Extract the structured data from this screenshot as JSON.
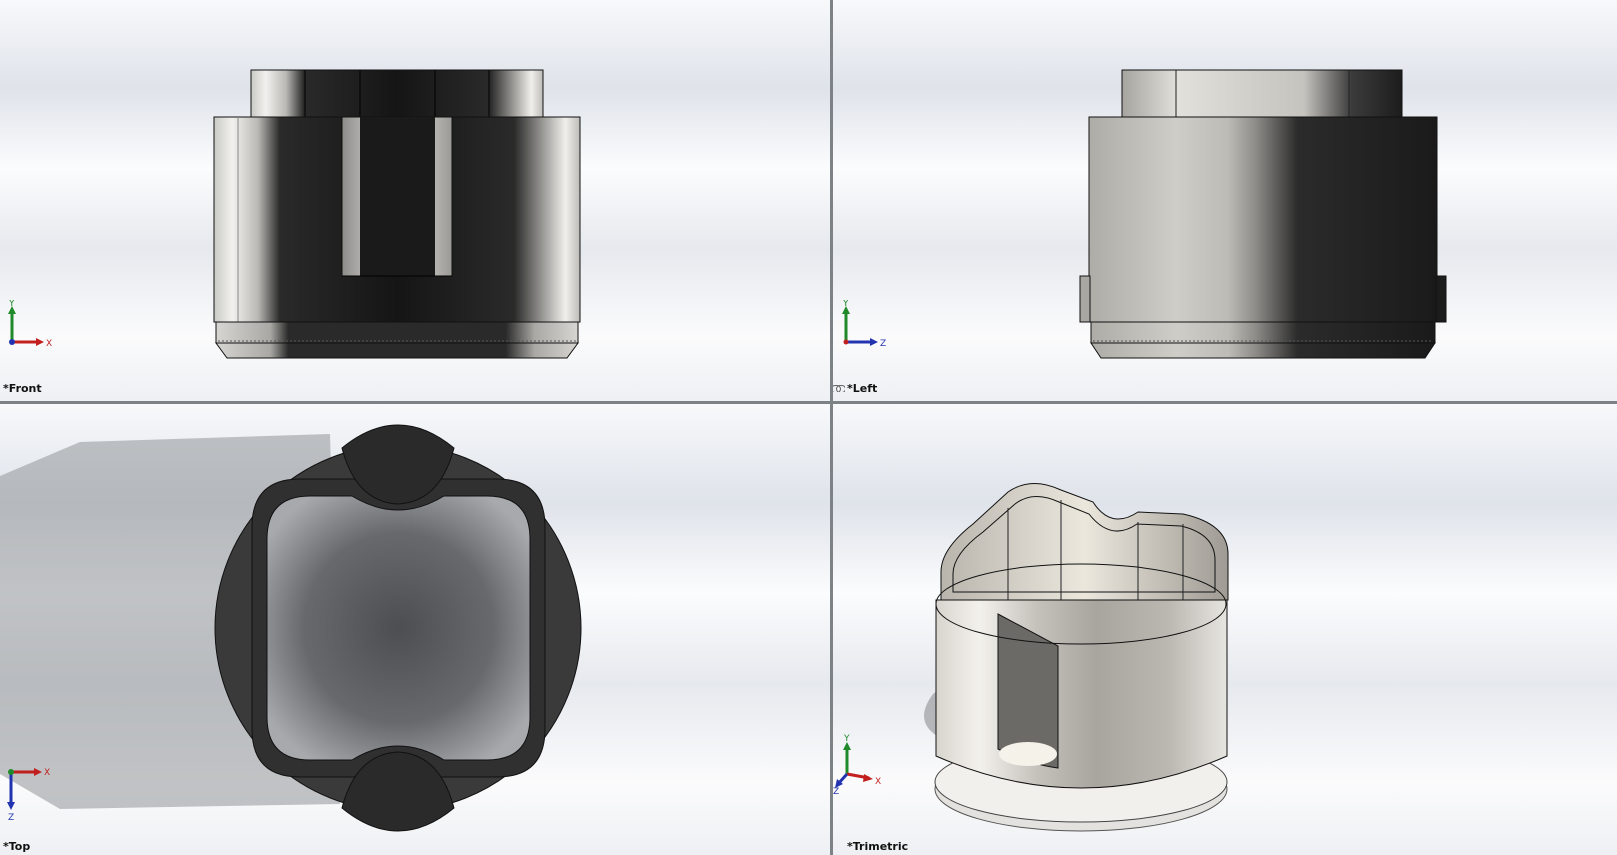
{
  "viewports": {
    "front": {
      "label": "*Front",
      "triad": {
        "up": "Y",
        "right": "X"
      }
    },
    "left": {
      "label": "*Left",
      "triad": {
        "up": "Y",
        "right": "Z"
      },
      "link_icon": "link-icon"
    },
    "top": {
      "label": "*Top",
      "triad": {
        "down": "Z",
        "right": "X"
      }
    },
    "trimetric": {
      "label": "*Trimetric",
      "triad": {
        "up": "Y",
        "left": "Z",
        "right": "X"
      }
    }
  },
  "colors": {
    "x_axis": "#c21f1f",
    "y_axis": "#1e8a2a",
    "z_axis": "#2233b0",
    "model_dark": "#1b1b1b",
    "model_light": "#c9c7c3",
    "splitter": "#7d8287"
  }
}
